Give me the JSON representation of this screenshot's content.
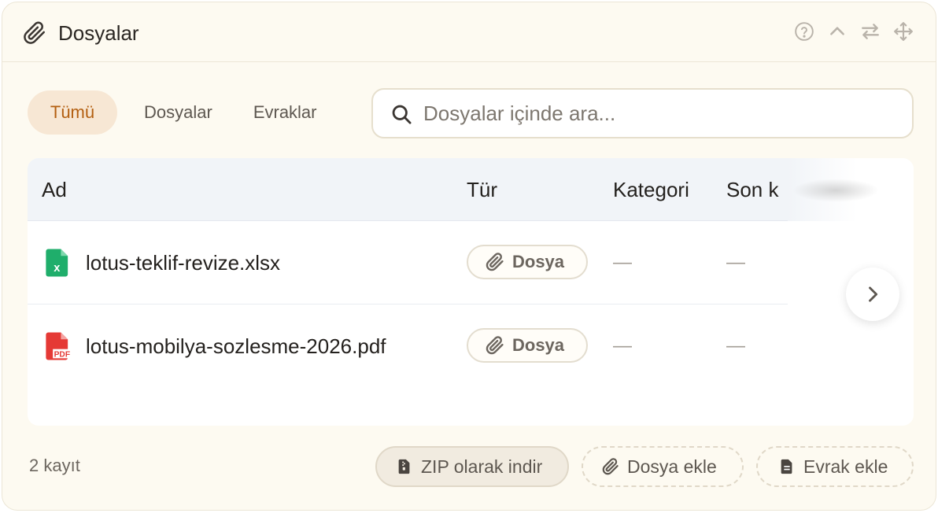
{
  "header": {
    "title": "Dosyalar",
    "icons": [
      "paperclip-icon",
      "help-icon",
      "chevron-up-icon",
      "swap-icon",
      "move-icon"
    ]
  },
  "tabs": [
    {
      "label": "Tümü",
      "active": true
    },
    {
      "label": "Dosyalar",
      "active": false
    },
    {
      "label": "Evraklar",
      "active": false
    }
  ],
  "search": {
    "placeholder": "Dosyalar içinde ara...",
    "value": ""
  },
  "table": {
    "columns": [
      "Ad",
      "Tür",
      "Kategori",
      "Son k"
    ],
    "rows": [
      {
        "icon": "excel-file-icon",
        "name": "lotus-teklif-revize.xlsx",
        "type": "Dosya",
        "category": "—",
        "last": "—"
      },
      {
        "icon": "pdf-file-icon",
        "name": "lotus-mobilya-sozlesme-2026.pdf",
        "type": "Dosya",
        "category": "—",
        "last": "—"
      }
    ]
  },
  "footer": {
    "count": "2 kayıt",
    "zip_label": "ZIP olarak indir",
    "add_file_label": "Dosya ekle",
    "add_doc_label": "Evrak ekle"
  },
  "colors": {
    "accent": "#b35f10",
    "accent_bg": "#f7e7d4",
    "panel_bg": "#fdfaf1",
    "excel_green": "#1fae6b",
    "pdf_red": "#e53935"
  }
}
